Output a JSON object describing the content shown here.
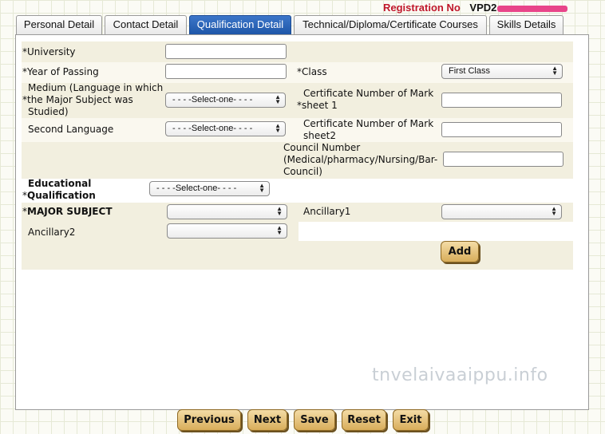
{
  "header": {
    "registration_label": "Registration No",
    "registration_value": "VPD2"
  },
  "tabs": [
    {
      "label": "Personal Detail",
      "active": false
    },
    {
      "label": "Contact Detail",
      "active": false
    },
    {
      "label": "Qualification Detail",
      "active": true
    },
    {
      "label": "Technical/Diploma/Certificate Courses",
      "active": false
    },
    {
      "label": "Skills Details",
      "active": false
    }
  ],
  "form": {
    "university": {
      "required": "*",
      "label": "University",
      "value": ""
    },
    "year_of_passing": {
      "required": "*",
      "label": "Year of Passing",
      "value": ""
    },
    "class": {
      "required": "*",
      "label": "Class",
      "selected": "First Class"
    },
    "medium": {
      "required": "*",
      "label_line1": "Medium (Language in which",
      "label_line2": "the Major Subject was",
      "label_line3": "Studied)",
      "selected": "- - - -Select-one- - - -"
    },
    "cert_mark_sheet1": {
      "required": "*",
      "label_line1": "Certificate Number of Mark",
      "label_line2": "sheet 1",
      "value": ""
    },
    "second_language": {
      "label": "Second Language",
      "selected": "- - - -Select-one- - - -"
    },
    "cert_mark_sheet2": {
      "label_line1": "Certificate Number of Mark",
      "label_line2": "sheet2",
      "value": ""
    },
    "council_number": {
      "label_line1": "Council Number",
      "label_line2": "(Medical/pharmacy/Nursing/Bar-",
      "label_line3": "Council)",
      "value": ""
    },
    "educational_qualification": {
      "required": "*",
      "label_line1": "Educational",
      "label_line2": "Qualification",
      "selected": "- - - -Select-one- - - -"
    },
    "major_subject": {
      "required": "*",
      "label": "MAJOR SUBJECT",
      "selected": ""
    },
    "ancillary1": {
      "label": "Ancillary1",
      "selected": ""
    },
    "ancillary2": {
      "label": "Ancillary2",
      "selected": ""
    },
    "add_label": "Add"
  },
  "footer": {
    "buttons": [
      "Previous",
      "Next",
      "Save",
      "Reset",
      "Exit"
    ]
  },
  "watermark": "tnvelaivaaippu.info",
  "colors": {
    "active_tab": "#1e56a8",
    "registration_label": "#c0172b",
    "band": "#f2efdf",
    "button": "#d8ad5a"
  }
}
